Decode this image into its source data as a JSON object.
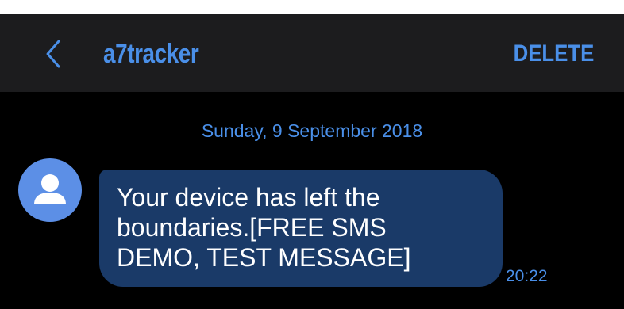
{
  "colors": {
    "accent": "#4a8fe8",
    "header_bg": "#1c1c1e",
    "bubble_bg": "#1a3a68",
    "avatar_bg": "#5c8fe6"
  },
  "header": {
    "back_icon": "chevron-left-icon",
    "title": "a7tracker",
    "delete_label": "DELETE"
  },
  "conversation": {
    "date": "Sunday, 9 September 2018",
    "messages": [
      {
        "sender_avatar_icon": "person-icon",
        "text": "Your device has left the\nboundaries.[FREE SMS\nDEMO, TEST MESSAGE]",
        "time": "20:22"
      }
    ]
  }
}
